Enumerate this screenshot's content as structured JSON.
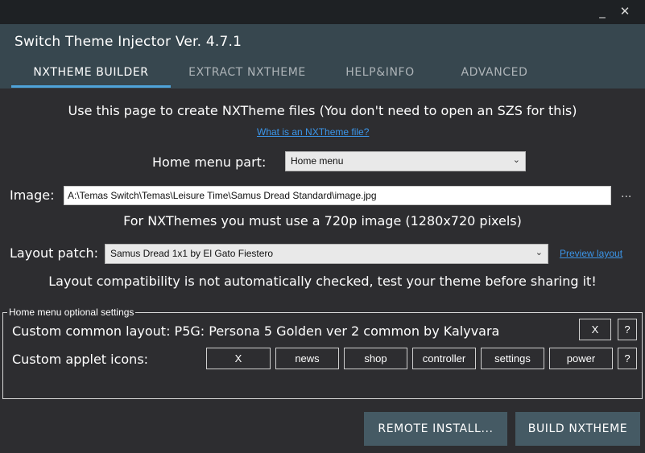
{
  "window": {
    "minimize_glyph": "_",
    "close_glyph": "✕"
  },
  "app": {
    "title": "Switch Theme Injector Ver. 4.7.1"
  },
  "tabs": [
    {
      "label": "NXTHEME BUILDER",
      "active": true
    },
    {
      "label": "EXTRACT NXTHEME",
      "active": false
    },
    {
      "label": "HELP&INFO",
      "active": false
    },
    {
      "label": "ADVANCED",
      "active": false
    }
  ],
  "intro": {
    "text": "Use this page to create NXTheme files (You don't need to open an SZS for this)",
    "link": "What is an NXTheme file?"
  },
  "home_menu_part": {
    "label": "Home menu part:",
    "value": "Home menu"
  },
  "image": {
    "label": "Image:",
    "value": "A:\\Temas Switch\\Temas\\Leisure Time\\Samus Dread Standard\\image.jpg",
    "browse": "..."
  },
  "image_note": "For NXThemes you must use a 720p image (1280x720 pixels)",
  "layout_patch": {
    "label": "Layout patch:",
    "value": "Samus Dread 1x1 by El Gato Fiestero",
    "preview_link": "Preview layout"
  },
  "layout_warning": "Layout compatibility is not automatically checked, test your theme before sharing it!",
  "optional_settings": {
    "legend": "Home menu optional settings",
    "common_layout_label": "Custom common layout: P5G: Persona 5 Golden ver 2 common by Kalyvara",
    "common_layout_clear": "X",
    "common_layout_help": "?",
    "applet_icons_label": "Custom applet icons:",
    "applet_buttons": [
      "X",
      "news",
      "shop",
      "controller",
      "settings",
      "power"
    ],
    "applet_help": "?"
  },
  "actions": {
    "remote_install": "REMOTE INSTALL...",
    "build": "BUILD NXTHEME"
  },
  "colors": {
    "background": "#2d2d30",
    "header": "#37474f",
    "titlebar": "#1e2124",
    "accent": "#4fa3d9",
    "link": "#3b95e8",
    "button": "#455a64"
  },
  "icons": {
    "dropdown": "chevron-down-icon"
  }
}
